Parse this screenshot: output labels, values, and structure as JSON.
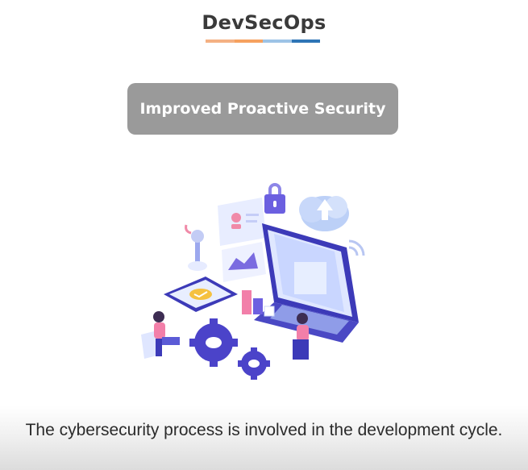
{
  "title": "DevSecOps",
  "title_underline_colors": [
    "#f4b183",
    "#f6a15f",
    "#9dc3e6",
    "#2e75b6"
  ],
  "badge": {
    "label": "Improved Proactive Security",
    "color": "#9a9a9a"
  },
  "illustration": {
    "icon": "cybersecurity-development-illustration",
    "accent": "#5b5bd6"
  },
  "caption": "The cybersecurity process is involved in the development cycle."
}
